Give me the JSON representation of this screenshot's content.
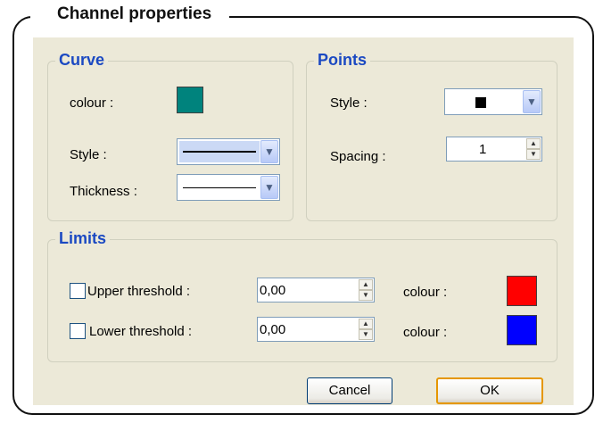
{
  "dialog": {
    "title": "Channel properties"
  },
  "curve": {
    "group_label": "Curve",
    "colour_label": "colour :",
    "colour_value": "#00837d",
    "style_label": "Style :",
    "thickness_label": "Thickness :"
  },
  "points": {
    "group_label": "Points",
    "style_label": "Style  :",
    "spacing_label": "Spacing :",
    "spacing_value": "1"
  },
  "limits": {
    "group_label": "Limits",
    "upper": {
      "label": "Upper threshold :",
      "checked": false,
      "value": "0,00",
      "colour_label": "colour :",
      "colour_value": "#ff0000"
    },
    "lower": {
      "label": "Lower threshold :",
      "checked": false,
      "value": "0,00",
      "colour_label": "colour :",
      "colour_value": "#0000ff"
    }
  },
  "buttons": {
    "cancel": "Cancel",
    "ok": "OK"
  }
}
